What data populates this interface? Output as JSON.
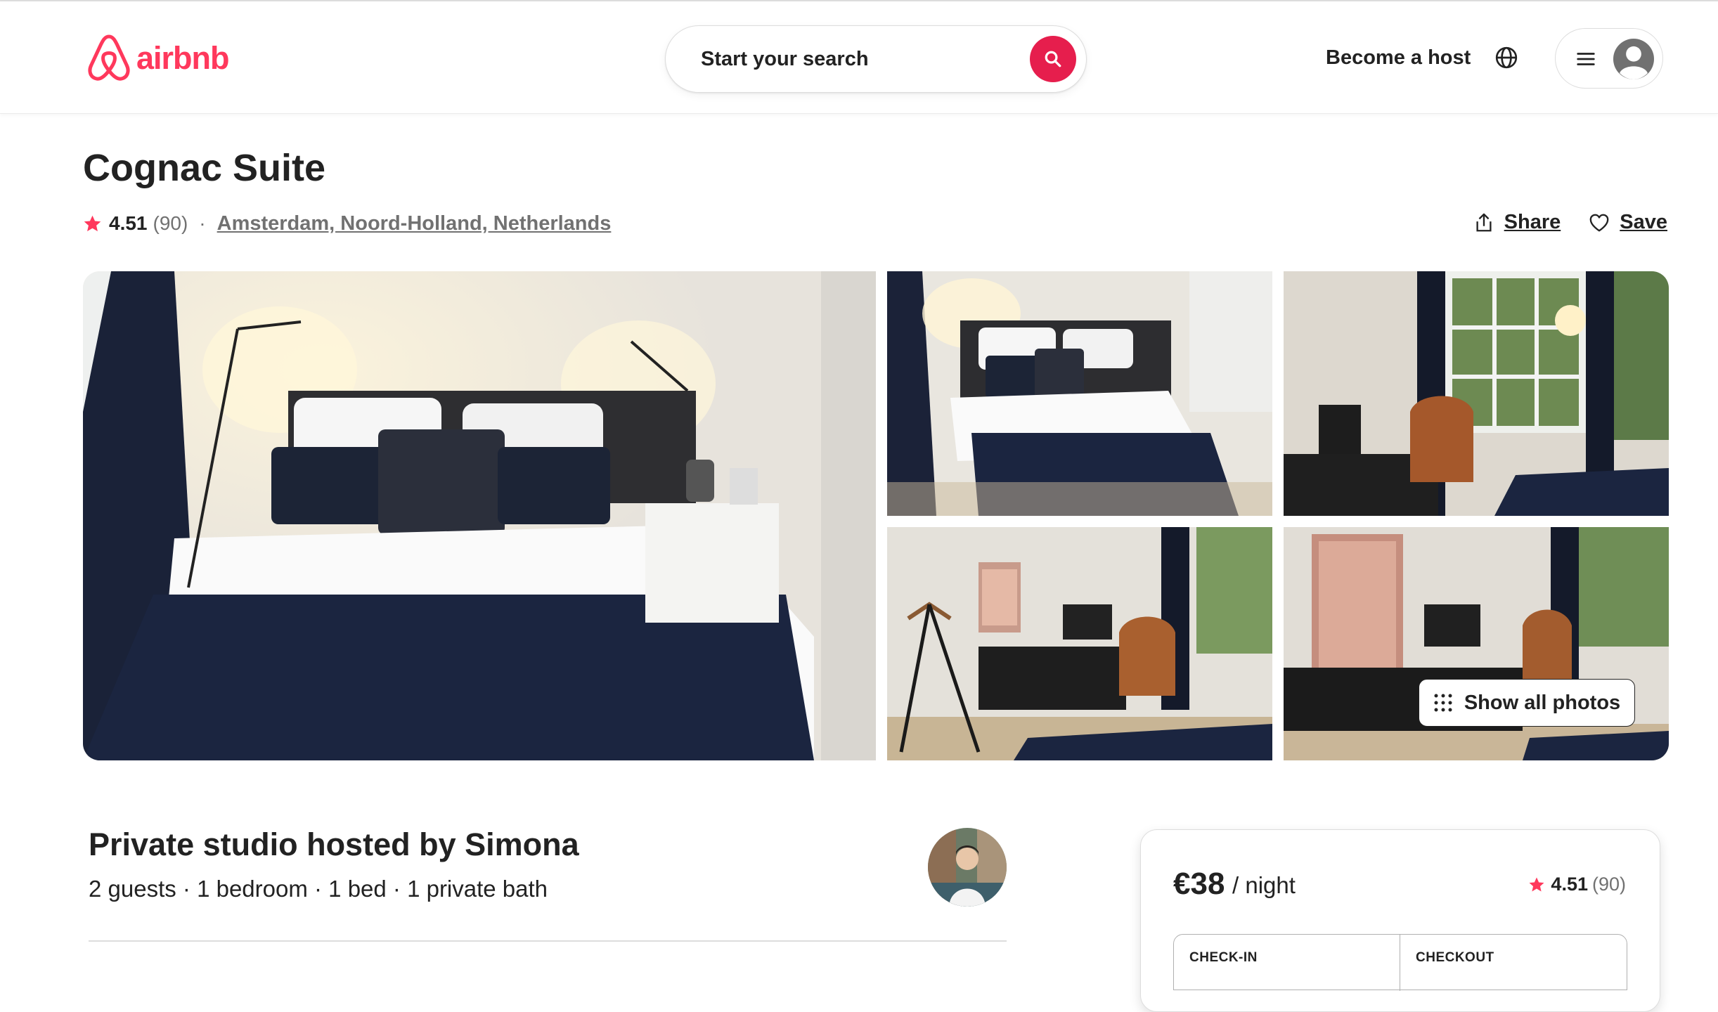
{
  "brand": {
    "name": "airbnb",
    "color": "#ff385c"
  },
  "header": {
    "search_placeholder": "Start your search",
    "become_host": "Become a host",
    "icons": [
      "search-icon",
      "globe-icon",
      "menu-icon",
      "user-avatar-icon"
    ]
  },
  "listing": {
    "title": "Cognac Suite",
    "rating": "4.51",
    "reviews": "(90)",
    "separator": "·",
    "location": "Amsterdam, Noord-Holland, Netherlands",
    "share_label": "Share",
    "save_label": "Save",
    "show_all_photos": "Show all photos"
  },
  "host_section": {
    "title": "Private studio hosted by Simona",
    "details": "2 guests · 1 bedroom · 1 bed · 1 private bath"
  },
  "booking": {
    "price": "€38",
    "per_night": "/ night",
    "rating": "4.51",
    "reviews": "(90)",
    "checkin_label": "CHECK-IN",
    "checkout_label": "CHECKOUT"
  },
  "colors": {
    "accent": "#ff385c",
    "search_button": "#e61e4d",
    "text": "#222222",
    "muted": "#717171"
  }
}
